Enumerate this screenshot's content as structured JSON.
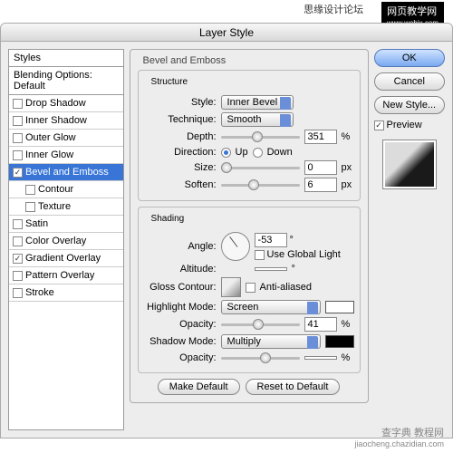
{
  "watermarks": {
    "top_left": "思缘设计论坛",
    "top_right_label": "网页教学网",
    "top_right_url": "www.webjx.com",
    "bottom_cn": "查字典 教程网",
    "bottom_url": "jiaocheng.chazidian.com"
  },
  "dialog": {
    "title": "Layer Style"
  },
  "left": {
    "header": "Styles",
    "subheader": "Blending Options: Default",
    "items": [
      {
        "label": "Drop Shadow",
        "checked": false
      },
      {
        "label": "Inner Shadow",
        "checked": false
      },
      {
        "label": "Outer Glow",
        "checked": false
      },
      {
        "label": "Inner Glow",
        "checked": false
      },
      {
        "label": "Bevel and Emboss",
        "checked": true,
        "selected": true
      },
      {
        "label": "Contour",
        "checked": false,
        "indent": true
      },
      {
        "label": "Texture",
        "checked": false,
        "indent": true
      },
      {
        "label": "Satin",
        "checked": false
      },
      {
        "label": "Color Overlay",
        "checked": false
      },
      {
        "label": "Gradient Overlay",
        "checked": true
      },
      {
        "label": "Pattern Overlay",
        "checked": false
      },
      {
        "label": "Stroke",
        "checked": false
      }
    ]
  },
  "panel": {
    "title": "Bevel and Emboss",
    "structure": {
      "title": "Structure",
      "style_label": "Style:",
      "style_value": "Inner Bevel",
      "technique_label": "Technique:",
      "technique_value": "Smooth",
      "depth_label": "Depth:",
      "depth_value": "351",
      "depth_unit": "%",
      "direction_label": "Direction:",
      "dir_up": "Up",
      "dir_down": "Down",
      "size_label": "Size:",
      "size_value": "0",
      "size_unit": "px",
      "soften_label": "Soften:",
      "soften_value": "6",
      "soften_unit": "px"
    },
    "shading": {
      "title": "Shading",
      "angle_label": "Angle:",
      "angle_value": "-53",
      "angle_unit": "°",
      "global_label": "Use Global Light",
      "altitude_label": "Altitude:",
      "altitude_value": "",
      "altitude_unit": "°",
      "gloss_label": "Gloss Contour:",
      "anti_label": "Anti-aliased",
      "highlight_label": "Highlight Mode:",
      "highlight_value": "Screen",
      "highlight_opacity_label": "Opacity:",
      "highlight_opacity_value": "41",
      "opacity_unit": "%",
      "shadow_label": "Shadow Mode:",
      "shadow_value": "Multiply",
      "shadow_opacity_label": "Opacity:",
      "shadow_opacity_value": ""
    },
    "make_default": "Make Default",
    "reset_default": "Reset to Default"
  },
  "buttons": {
    "ok": "OK",
    "cancel": "Cancel",
    "new_style": "New Style...",
    "preview": "Preview"
  },
  "colors": {
    "highlight": "#ffffff",
    "shadow": "#000000"
  }
}
